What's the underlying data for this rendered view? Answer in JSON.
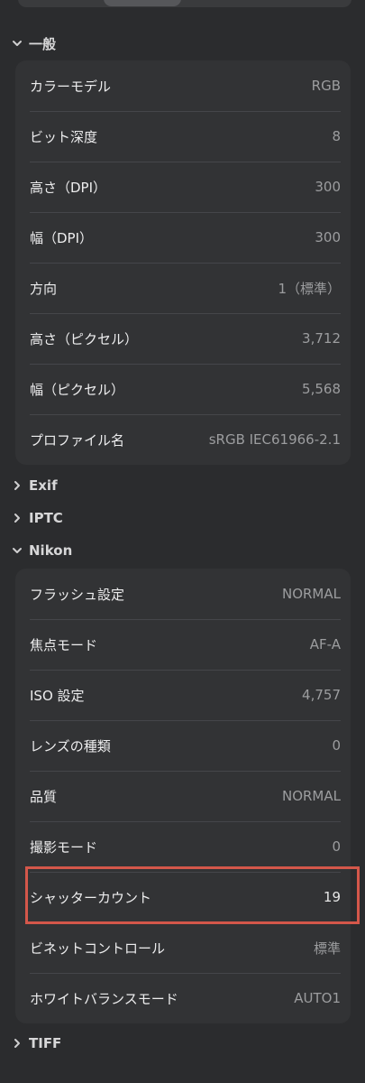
{
  "sections": {
    "general": {
      "title": "一般",
      "rows": [
        {
          "label": "カラーモデル",
          "value": "RGB"
        },
        {
          "label": "ビット深度",
          "value": "8"
        },
        {
          "label": "高さ（DPI）",
          "value": "300"
        },
        {
          "label": "幅（DPI）",
          "value": "300"
        },
        {
          "label": "方向",
          "value": "1（標準）"
        },
        {
          "label": "高さ（ピクセル）",
          "value": "3,712"
        },
        {
          "label": "幅（ピクセル）",
          "value": "5,568"
        },
        {
          "label": "プロファイル名",
          "value": "sRGB IEC61966-2.1"
        }
      ]
    },
    "exif": {
      "title": "Exif"
    },
    "iptc": {
      "title": "IPTC"
    },
    "nikon": {
      "title": "Nikon",
      "rows": [
        {
          "label": "フラッシュ設定",
          "value": "NORMAL"
        },
        {
          "label": "焦点モード",
          "value": "AF-A"
        },
        {
          "label": "ISO 設定",
          "value": "4,757"
        },
        {
          "label": "レンズの種類",
          "value": "0"
        },
        {
          "label": "品質",
          "value": "NORMAL"
        },
        {
          "label": "撮影モード",
          "value": "0"
        },
        {
          "label": "シャッターカウント",
          "value": "19"
        },
        {
          "label": "ビネットコントロール",
          "value": "標準"
        },
        {
          "label": "ホワイトバランスモード",
          "value": "AUTO1"
        }
      ]
    },
    "tiff": {
      "title": "TIFF"
    }
  },
  "colors": {
    "background": "#2b2c2e",
    "panel": "#323335",
    "highlight": "#d4574a"
  }
}
